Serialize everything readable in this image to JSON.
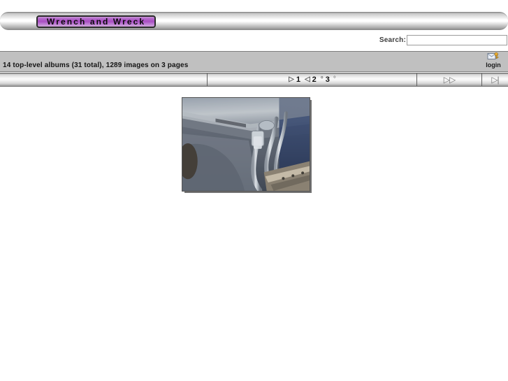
{
  "header": {
    "site_title": "Wrench and Wreck",
    "title_bg_color": "#a94ec2",
    "band_color": "#ffffff"
  },
  "search": {
    "label": "Search:",
    "value": "",
    "placeholder": ""
  },
  "info": {
    "summary": "14 top-level albums (31 total), 1289 images on 3 pages",
    "bg_color": "#c0c0c0"
  },
  "login": {
    "label": "login",
    "icon": "login-key-icon"
  },
  "pagination": {
    "prev_cell": "",
    "pages": [
      {
        "arrow": "▷",
        "label": "1",
        "current": true
      },
      {
        "arrow": "◁",
        "label": "2",
        "current": false
      },
      {
        "arrow": "°",
        "label": "3",
        "current": false
      },
      {
        "arrow": "°",
        "label": "",
        "current": false
      }
    ],
    "next_glyph": "▷▷",
    "last_glyph": "▷|"
  },
  "thumbnail": {
    "alt": "vehicle undercarriage with metal pipes and brackets",
    "width": 184,
    "height": 135
  }
}
